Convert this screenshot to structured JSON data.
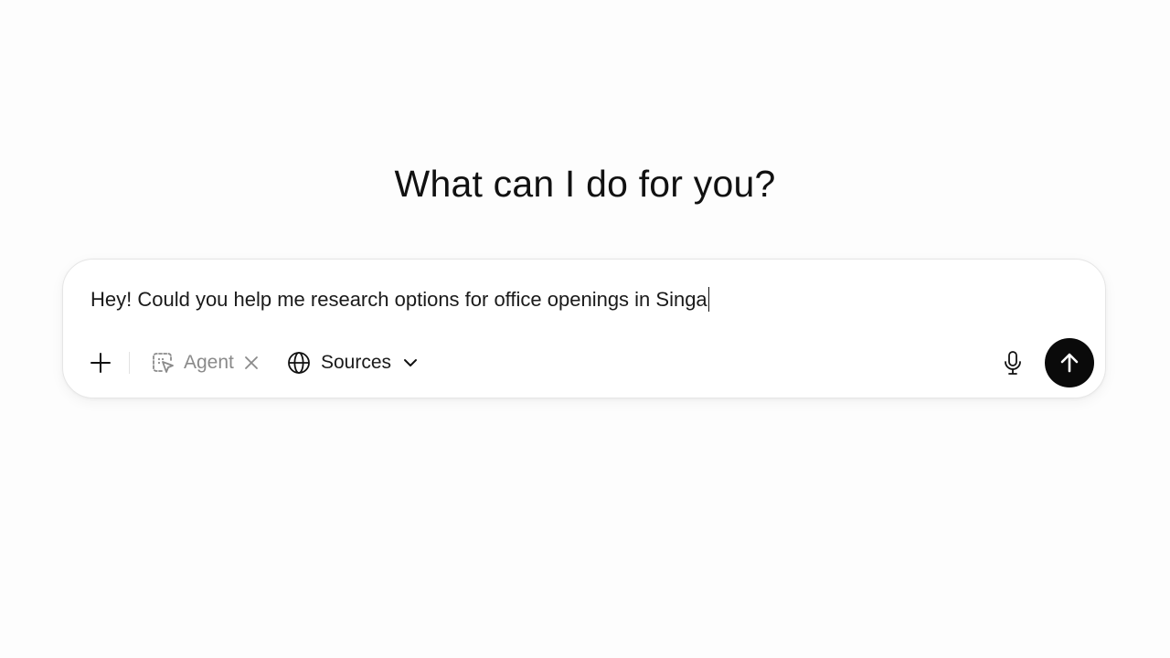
{
  "heading": "What can I do for you?",
  "composer": {
    "input_value": "Hey! Could you help me research options for office openings in Singa",
    "add_icon": "plus-icon",
    "agent_chip": {
      "label": "Agent",
      "icon": "agent-cursor-icon",
      "remove_icon": "close-icon"
    },
    "sources": {
      "label": "Sources",
      "icon": "globe-icon",
      "dropdown_icon": "chevron-down-icon"
    },
    "mic_icon": "microphone-icon",
    "send_icon": "arrow-up-icon"
  },
  "colors": {
    "background": "#fdfdfd",
    "send_button": "#0a0a0a",
    "muted_text": "#8a8a8a"
  }
}
